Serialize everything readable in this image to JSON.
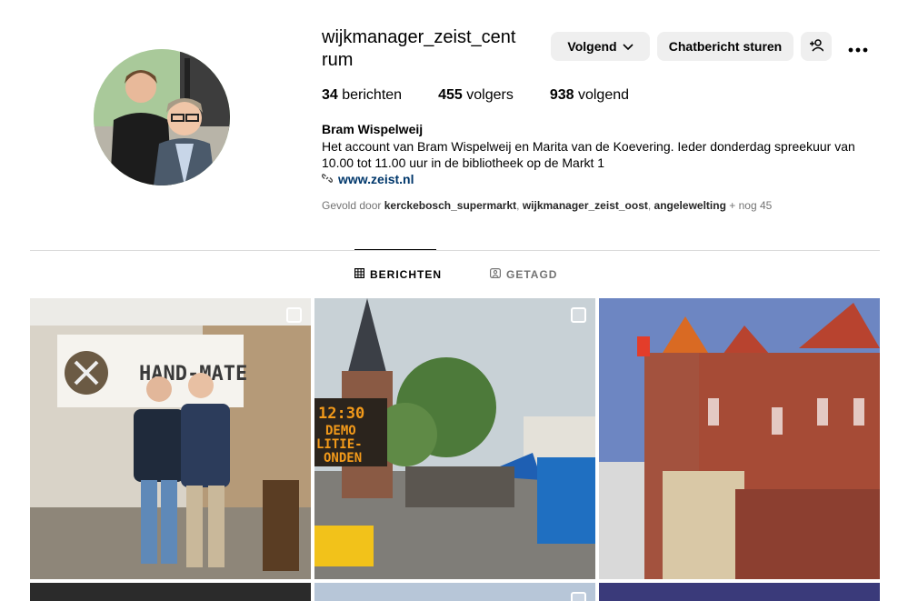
{
  "profile": {
    "username": "wijkmanager_zeist_centrum",
    "full_name": "Bram Wispelweij",
    "bio": "Het account van Bram Wispelweij en Marita van de Koevering. Ieder donderdag spreekuur van 10.00 tot 11.00 uur in de bibliotheek op de Markt 1",
    "website": "www.zeist.nl",
    "icon_link": "link-icon"
  },
  "actions": {
    "follow_label": "Volgend",
    "message_label": "Chatbericht sturen",
    "add_icon": "person-add-icon",
    "more_icon": "more-icon"
  },
  "stats": {
    "posts_count": "34",
    "posts_label": "berichten",
    "followers_count": "455",
    "followers_label": "volgers",
    "following_count": "938",
    "following_label": "volgend"
  },
  "followed_by": {
    "prefix": "Gevold door",
    "accounts": [
      "kerckebosch_supermarkt",
      "wijkmanager_zeist_oost",
      "angelewelting"
    ],
    "more": "+ nog 45"
  },
  "tabs": [
    {
      "label": "BERICHTEN",
      "icon": "grid-icon",
      "active": true
    },
    {
      "label": "GETAGD",
      "icon": "tagged-icon",
      "active": false
    }
  ],
  "posts": {
    "p1_sign": "HAND-MATE",
    "p2_sign_lines": [
      "12:30",
      "DEMO",
      "LITIE-",
      "ONDEN"
    ]
  },
  "colors": {
    "button_bg": "#efefef",
    "link": "#00376b",
    "muted": "#737373",
    "divider": "#dbdbdb"
  }
}
